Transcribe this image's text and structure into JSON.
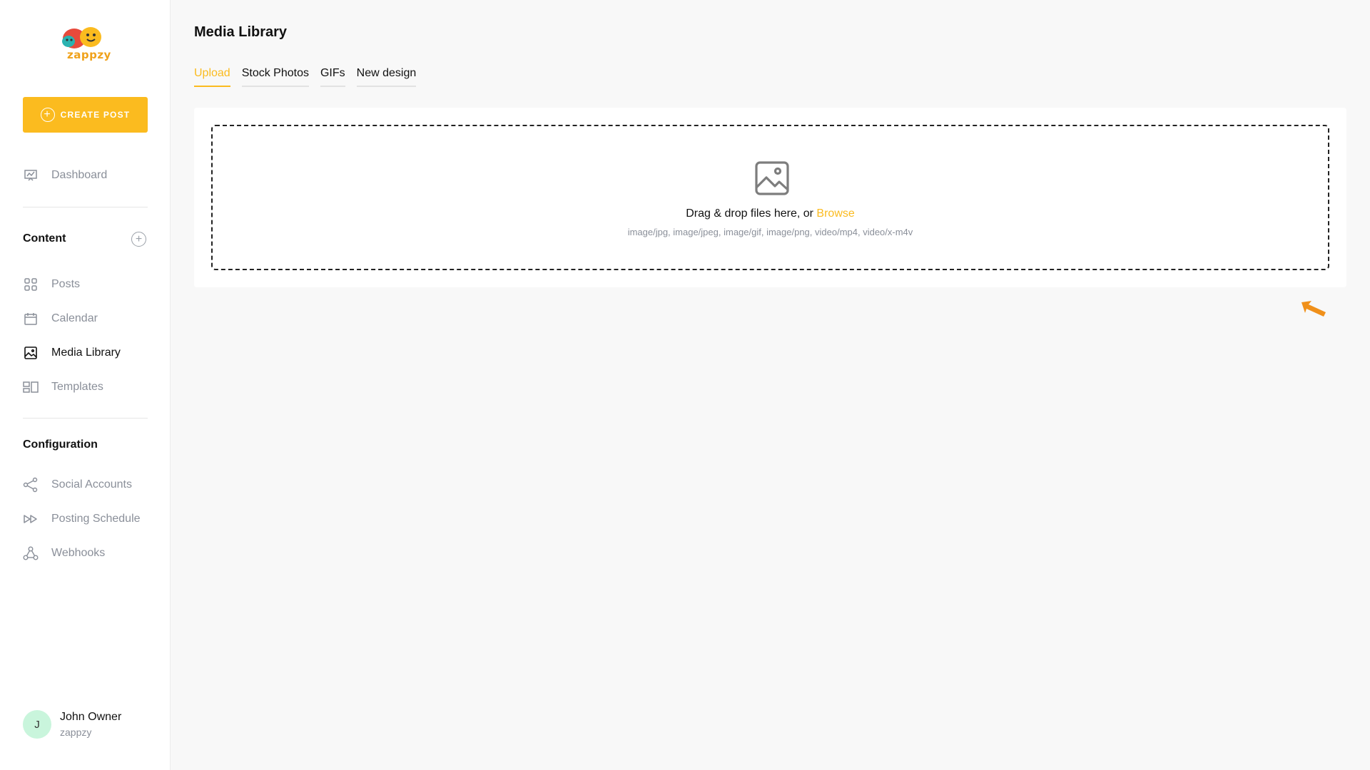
{
  "brand": {
    "name": "zappzy"
  },
  "sidebar": {
    "create_post": "CREATE POST",
    "dashboard": "Dashboard",
    "content_title": "Content",
    "content_items": [
      {
        "label": "Posts",
        "icon": "grid-icon"
      },
      {
        "label": "Calendar",
        "icon": "calendar-icon"
      },
      {
        "label": "Media Library",
        "icon": "image-icon",
        "active": true
      },
      {
        "label": "Templates",
        "icon": "templates-icon"
      }
    ],
    "configuration_title": "Configuration",
    "configuration_items": [
      {
        "label": "Social Accounts",
        "icon": "share-icon"
      },
      {
        "label": "Posting Schedule",
        "icon": "fast-forward-icon"
      },
      {
        "label": "Webhooks",
        "icon": "webhook-icon"
      }
    ],
    "user": {
      "initial": "J",
      "name": "John Owner",
      "org": "zappzy"
    }
  },
  "main": {
    "title": "Media Library",
    "tabs": [
      {
        "label": "Upload",
        "active": true
      },
      {
        "label": "Stock Photos"
      },
      {
        "label": "GIFs"
      },
      {
        "label": "New design"
      }
    ],
    "dropzone": {
      "text": "Drag & drop files here, or ",
      "browse": "Browse",
      "types": "image/jpg, image/jpeg, image/gif, image/png, video/mp4, video/x-m4v"
    }
  },
  "colors": {
    "accent": "#fbbb1f",
    "pointer_arrow": "#f0901a",
    "avatar_bg": "#c9f5dc"
  }
}
